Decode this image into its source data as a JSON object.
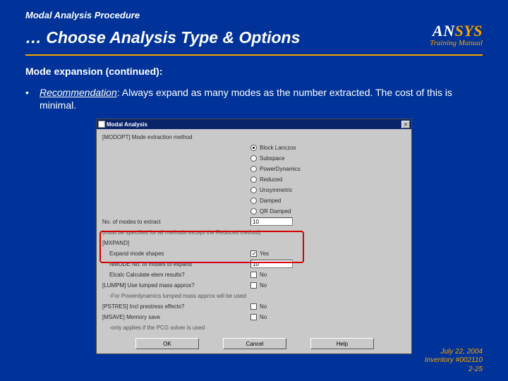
{
  "header": {
    "supertitle": "Modal Analysis Procedure",
    "title": "… Choose Analysis Type & Options",
    "logo_an": "AN",
    "logo_sys": "SYS",
    "training_manual": "Training Manual"
  },
  "content": {
    "subhead": "Mode expansion (continued):",
    "bullet_lead": "Recommendation",
    "bullet_rest": ":  Always expand as many modes as the number extracted.  The cost of this is minimal."
  },
  "dialog": {
    "title": "Modal Analysis",
    "heading": "[MODOPT]  Mode extraction method",
    "methods": [
      {
        "label": "Block Lanczos",
        "selected": true
      },
      {
        "label": "Subspace",
        "selected": false
      },
      {
        "label": "PowerDynamics",
        "selected": false
      },
      {
        "label": "Reduced",
        "selected": false
      },
      {
        "label": "Unsymmetric",
        "selected": false
      },
      {
        "label": "Damped",
        "selected": false
      },
      {
        "label": "QR Damped",
        "selected": false
      }
    ],
    "nmodes_label": "No. of modes to extract",
    "nmodes_value": "10",
    "note": "(must be specified for all methods except the Reduced method)",
    "mxpand_header": "[MXPAND]",
    "expand_label": "Expand mode shapes",
    "expand_checked": true,
    "expand_yes": "Yes",
    "nmode_label": "NMODE No. of modes to expand",
    "nmode_value": "10",
    "elcalc_label": "Elcalc Calculate elem results?",
    "elcalc_checked": false,
    "elcalc_no": "No",
    "lumpm_label": "[LUMPM]  Use lumped mass approx?",
    "lumpm_checked": false,
    "lumpm_no": "No",
    "lumpm_note": "-For Powerdynamics lumped mass approx will be used",
    "pstres_label": "[PSTRES]  Incl prestress effects?",
    "pstres_checked": false,
    "pstres_no": "No",
    "memory_label": "[MSAVE] Memory save",
    "memory_checked": false,
    "memory_no": "No",
    "memory_note": "-only applies if the PCG solver is used",
    "btn_ok": "OK",
    "btn_cancel": "Cancel",
    "btn_help": "Help"
  },
  "footer": {
    "date": "July 22, 2004",
    "inv": "Inventory #002110",
    "page": "2-25"
  }
}
